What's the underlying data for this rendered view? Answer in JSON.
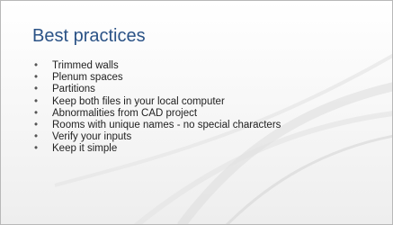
{
  "slide": {
    "title": "Best practices",
    "bullet_glyph": "•",
    "bullets": [
      "Trimmed walls",
      "Plenum spaces",
      "Partitions",
      "Keep both files in your local computer",
      "Abnormalities from CAD project",
      "Rooms with unique names - no special characters",
      "Verify your inputs",
      "Keep it simple"
    ]
  },
  "colors": {
    "title": "#2a5286",
    "text": "#222222",
    "swoosh": "#d9d9d9"
  }
}
